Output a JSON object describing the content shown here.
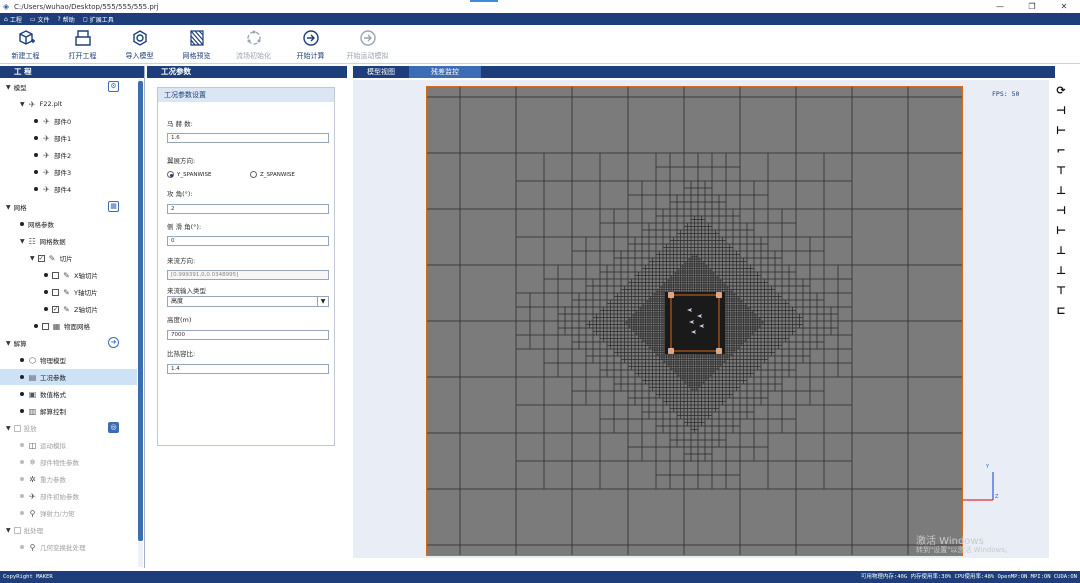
{
  "title_bar": {
    "path": "C:/Users/wuhao/Desktop/555/555/555.prj"
  },
  "menu": [
    {
      "label": "工程",
      "icon": "home-icon"
    },
    {
      "label": "文件",
      "icon": "folder-icon"
    },
    {
      "label": "帮助",
      "icon": "help-icon"
    },
    {
      "label": "扩展工具",
      "icon": "extension-icon"
    }
  ],
  "toolbar": [
    {
      "label": "新建工程",
      "icon": "new-project-icon",
      "enabled": true
    },
    {
      "label": "打开工程",
      "icon": "open-project-icon",
      "enabled": true
    },
    {
      "label": "导入模型",
      "icon": "import-model-icon",
      "enabled": true
    },
    {
      "label": "网格预览",
      "icon": "mesh-preview-icon",
      "enabled": true
    },
    {
      "label": "流场初始化",
      "icon": "flow-init-icon",
      "enabled": false
    },
    {
      "label": "开始计算",
      "icon": "start-compute-icon",
      "enabled": true
    },
    {
      "label": "开始运动模拟",
      "icon": "start-motion-icon",
      "enabled": false
    }
  ],
  "left_panel": {
    "title": "工 程",
    "tree": [
      {
        "label": "模型",
        "kind": "section"
      },
      {
        "label": "F22.plt",
        "kind": "node"
      },
      {
        "label": "部件0"
      },
      {
        "label": "部件1"
      },
      {
        "label": "部件2"
      },
      {
        "label": "部件3"
      },
      {
        "label": "部件4"
      },
      {
        "label": "网格",
        "kind": "section"
      },
      {
        "label": "网格参数"
      },
      {
        "label": "网格数据"
      },
      {
        "label": "切片"
      },
      {
        "label": "X轴切片"
      },
      {
        "label": "Y轴切片"
      },
      {
        "label": "Z轴切片"
      },
      {
        "label": "物面网格"
      },
      {
        "label": "解算",
        "kind": "section"
      },
      {
        "label": "物理模型"
      },
      {
        "label": "工况参数",
        "selected": true
      },
      {
        "label": "数值格式"
      },
      {
        "label": "解算控制"
      },
      {
        "label": "投放",
        "kind": "section",
        "disabled": true
      },
      {
        "label": "运动模拟",
        "disabled": true
      },
      {
        "label": "部件物性参数",
        "disabled": true
      },
      {
        "label": "重力参数",
        "disabled": true
      },
      {
        "label": "部件初始参数",
        "disabled": true
      },
      {
        "label": "弹射力/力矩",
        "disabled": true
      },
      {
        "label": "批处理",
        "kind": "section",
        "disabled": true
      },
      {
        "label": "几何变换批处理",
        "disabled": true
      }
    ]
  },
  "mid_panel": {
    "title": "工况参数",
    "section": "工况参数设置",
    "fields": {
      "mach_label": "马 赫 数:",
      "mach_value": "1.6",
      "span_label": "翼展方向:",
      "span_opt1": "Y_SPANWISE",
      "span_opt2": "Z_SPANWISE",
      "span_selected": "Y_SPANWISE",
      "aoa_label": "攻    角(°):",
      "aoa_value": "2",
      "slip_label": "侧 滑 角(°):",
      "slip_value": "0",
      "dir_label": "来流方向:",
      "dir_value": "[0.999391,0,0.0348995]",
      "input_type_label": "来流输入类型",
      "input_type_value": "高度",
      "height_label": "高度(m)",
      "height_value": "7000",
      "gamma_label": "比热容比:",
      "gamma_value": "1.4"
    }
  },
  "view_tabs": [
    {
      "label": "模型视图",
      "active": false
    },
    {
      "label": "残差监控",
      "active": true
    }
  ],
  "viewport": {
    "fps": "FPS: 50",
    "axis_x": "X",
    "axis_y": "Y",
    "axis_z": "Z",
    "bg": "#7b7b7b",
    "accent": "#d2691e"
  },
  "right_tools": [
    "⟳",
    "⊣",
    "⊢",
    "⌐",
    "⊤",
    "⊥",
    "⊣",
    "⊢",
    "⊥",
    "⊥",
    "⊤",
    "⊏"
  ],
  "watermark": {
    "line1": "激活 Windows",
    "line2": "转到\"设置\"以激活 Windows。"
  },
  "status_bar": {
    "left": "CopyRight MAKER",
    "right": "可用物理内存:40G    内存使用率:30%   CPU使用率:48%   OpenMP:ON   MPI:ON   CUDA:ON"
  }
}
